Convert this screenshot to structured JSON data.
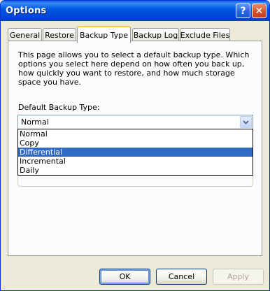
{
  "window": {
    "title": "Options",
    "help_symbol": "?",
    "close_symbol": "✕"
  },
  "tabs": [
    {
      "label": "General"
    },
    {
      "label": "Restore"
    },
    {
      "label": "Backup Type"
    },
    {
      "label": "Backup Log"
    },
    {
      "label": "Exclude Files"
    }
  ],
  "active_tab": "Backup Type",
  "panel": {
    "description": "This page allows you to select a default backup type. Which options you select here depend on how often you back up, how quickly you want to restore, and how much storage space you have.",
    "default_type_label": "Default Backup Type:",
    "combo_value": "Normal",
    "options": [
      "Normal",
      "Copy",
      "Differential",
      "Incremental",
      "Daily"
    ],
    "highlighted_option": "Differential"
  },
  "buttons": {
    "ok": "OK",
    "cancel": "Cancel",
    "apply": "Apply"
  },
  "colors": {
    "titlebar": "#0058e6",
    "selection": "#316ac5",
    "active_tab_accent": "#ffc83c"
  }
}
